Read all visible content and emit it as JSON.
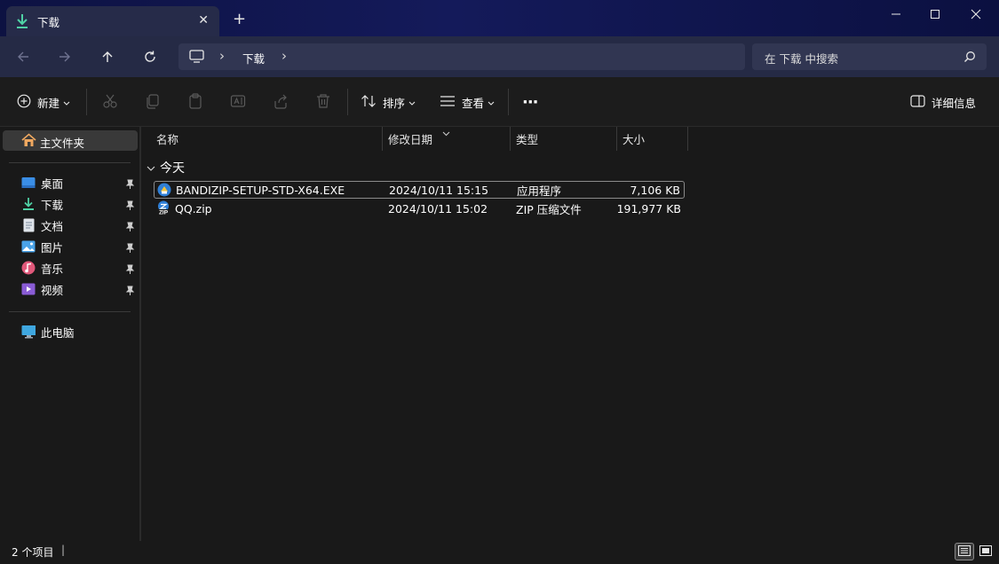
{
  "tab": {
    "title": "下载",
    "close": "✕",
    "new_tab": "+"
  },
  "window_controls": {
    "minimize": "—",
    "maximize": "☐",
    "close": "✕"
  },
  "address": {
    "segment": "下载",
    "separator": "›"
  },
  "search": {
    "placeholder": "在 下载 中搜索"
  },
  "toolbar": {
    "new_label": "新建",
    "sort_label": "排序",
    "view_label": "查看",
    "more_label": "···",
    "details_label": "详细信息"
  },
  "sidebar": {
    "home": "主文件夹",
    "quick": [
      {
        "label": "桌面",
        "icon": "desktop-icon"
      },
      {
        "label": "下载",
        "icon": "download-icon"
      },
      {
        "label": "文档",
        "icon": "document-icon"
      },
      {
        "label": "图片",
        "icon": "picture-icon"
      },
      {
        "label": "音乐",
        "icon": "music-icon"
      },
      {
        "label": "视频",
        "icon": "video-icon"
      }
    ],
    "this_pc": "此电脑"
  },
  "columns": {
    "name": "名称",
    "modified": "修改日期",
    "type": "类型",
    "size": "大小"
  },
  "group": {
    "label": "今天"
  },
  "files": [
    {
      "name": "BANDIZIP-SETUP-STD-X64.EXE",
      "modified": "2024/10/11 15:15",
      "type": "应用程序",
      "size": "7,106 KB",
      "icon": "exe-icon"
    },
    {
      "name": "QQ.zip",
      "modified": "2024/10/11 15:02",
      "type": "ZIP 压缩文件",
      "size": "191,977 KB",
      "icon": "zip-icon"
    }
  ],
  "status": {
    "count": "2 个项目",
    "separator": "|"
  },
  "colors": {
    "accent": "#4cc2ff",
    "titlebar": "#141a5a",
    "background": "#191919"
  }
}
